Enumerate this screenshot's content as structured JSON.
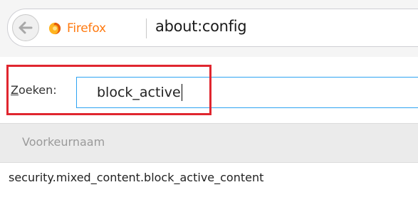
{
  "url_bar": {
    "identity_label": "Firefox",
    "url": "about:config"
  },
  "search": {
    "label_accesskey": "Z",
    "label_rest": "oeken:",
    "value": "block_active"
  },
  "table": {
    "column_header": "Voorkeurnaam",
    "rows": [
      {
        "name": "security.mixed_content.block_active_content"
      }
    ]
  },
  "colors": {
    "identity_label": "#ff7a10",
    "search_focus_border": "#2ea3f2",
    "highlight_annotation": "#e0262f"
  },
  "icons": {
    "back": "arrow-left",
    "identity": "firefox-logo"
  }
}
